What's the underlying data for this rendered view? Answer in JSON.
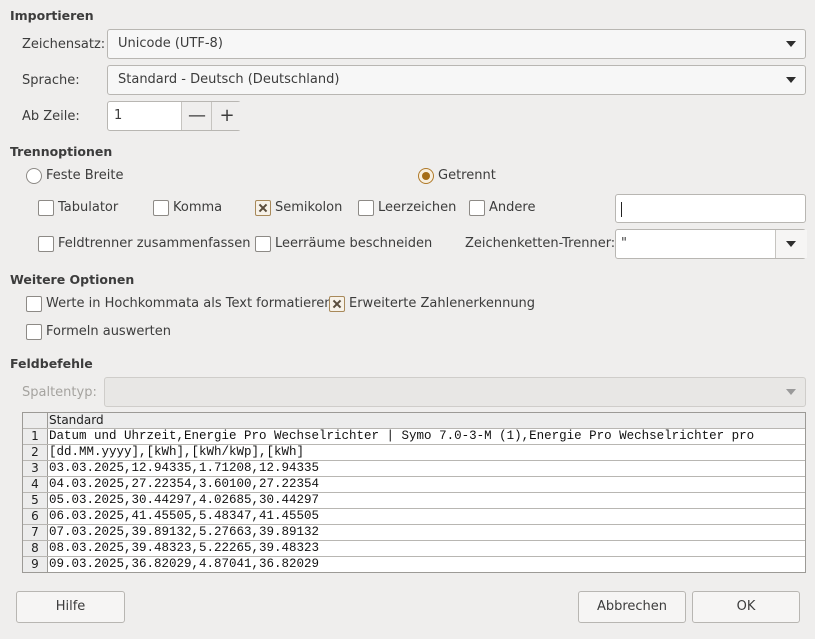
{
  "import": {
    "section_title": "Importieren",
    "charset_label": "Zeichensatz:",
    "charset_value": "Unicode (UTF-8)",
    "language_label": "Sprache:",
    "language_value": "Standard - Deutsch (Deutschland)",
    "from_row_label": "Ab Zeile:",
    "from_row_value": "1",
    "minus": "—",
    "plus": "+"
  },
  "separator": {
    "section_title": "Trennoptionen",
    "fixed_width": "Feste Breite",
    "separated": "Getrennt",
    "mode_selected": "Getrennt",
    "tab": "Tabulator",
    "comma": "Komma",
    "semicolon": "Semikolon",
    "space": "Leerzeichen",
    "other": "Andere",
    "other_value": "",
    "merge_delimiters": "Feldtrenner zusammenfassen",
    "trim_spaces": "Leerräume beschneiden",
    "string_delimiter_label": "Zeichenketten-Trenner:",
    "string_delimiter_value": "\"",
    "checked": {
      "tab": false,
      "comma": false,
      "semicolon": true,
      "space": false,
      "other": false,
      "merge_delimiters": false,
      "trim_spaces": false
    }
  },
  "other_options": {
    "section_title": "Weitere Optionen",
    "quoted_as_text": "Werte in Hochkommata als Text formatieren",
    "detect_special_numbers": "Erweiterte Zahlenerkennung",
    "evaluate_formulas": "Formeln auswerten",
    "checked": {
      "quoted_as_text": false,
      "detect_special_numbers": true,
      "evaluate_formulas": false
    }
  },
  "fields": {
    "section_title": "Feldbefehle",
    "column_type_label": "Spaltentyp:",
    "column_type_value": ""
  },
  "preview": {
    "column_header": "Standard",
    "rows": [
      {
        "num": "1",
        "text": "Datum und Uhrzeit,Energie Pro Wechselrichter | Symo 7.0-3-M (1),Energie Pro Wechselrichter pro"
      },
      {
        "num": "2",
        "text": "[dd.MM.yyyy],[kWh],[kWh/kWp],[kWh]"
      },
      {
        "num": "3",
        "text": "03.03.2025,12.94335,1.71208,12.94335"
      },
      {
        "num": "4",
        "text": "04.03.2025,27.22354,3.60100,27.22354"
      },
      {
        "num": "5",
        "text": "05.03.2025,30.44297,4.02685,30.44297"
      },
      {
        "num": "6",
        "text": "06.03.2025,41.45505,5.48347,41.45505"
      },
      {
        "num": "7",
        "text": "07.03.2025,39.89132,5.27663,39.89132"
      },
      {
        "num": "8",
        "text": "08.03.2025,39.48323,5.22265,39.48323"
      },
      {
        "num": "9",
        "text": "09.03.2025,36.82029,4.87041,36.82029"
      }
    ]
  },
  "buttons": {
    "help": "Hilfe",
    "cancel": "Abbrechen",
    "ok": "OK"
  }
}
